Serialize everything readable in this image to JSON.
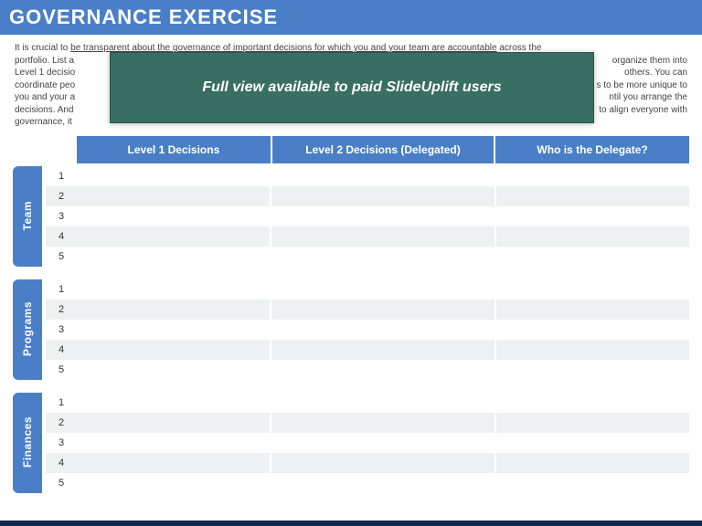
{
  "title": "GOVERNANCE EXERCISE",
  "intro_visible": {
    "line1_pre": "It is crucial to ",
    "line1_u": "be transparent about the governance of important  decisions for which you and your team are accountable",
    "line1_post": " across the",
    "line2_a": "portfolio. List a",
    "line2_b": " organize them into",
    "line3_a": "Level 1 decisio",
    "line3_b": "others. You can",
    "line4_a": "coordinate peo",
    "line4_b": "s to be more  unique to",
    "line5_a": "you  and your a",
    "line5_b": "ntil you arrange the",
    "line6_a": "decisions. And",
    "line6_b": "to align  everyone with",
    "line7_a": "governance, it"
  },
  "headers": {
    "col1": "Level 1 Decisions",
    "col2": "Level 2 Decisions  (Delegated)",
    "col3": "Who is the Delegate?"
  },
  "sections": [
    {
      "label": "Team",
      "rows": [
        "1",
        "2",
        "3",
        "4",
        "5"
      ]
    },
    {
      "label": "Programs",
      "rows": [
        "1",
        "2",
        "3",
        "4",
        "5"
      ]
    },
    {
      "label": "Finances",
      "rows": [
        "1",
        "2",
        "3",
        "4",
        "5"
      ]
    }
  ],
  "overlay_text": "Full view available to paid SlideUplift users",
  "colors": {
    "accent": "#4a7fc7",
    "overlay_bg": "#396e62",
    "footer": "#0d2b4b"
  }
}
